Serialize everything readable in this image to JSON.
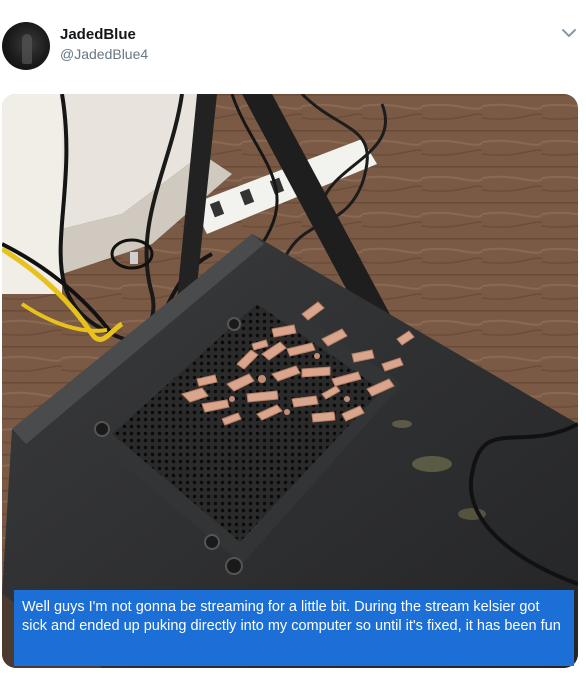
{
  "tweet": {
    "display_name": "JadedBlue",
    "handle": "@JadedBlue4",
    "caption": "Well guys I'm not gonna be streaming for a little bit. During the stream kelsier got sick and ended up puking directly into my computer so until it's fixed, it has been fun"
  },
  "icons": {
    "more": "chevron-down-icon"
  },
  "colors": {
    "caption_bg": "#1b6fd6",
    "name": "#14171a",
    "handle": "#657786"
  }
}
